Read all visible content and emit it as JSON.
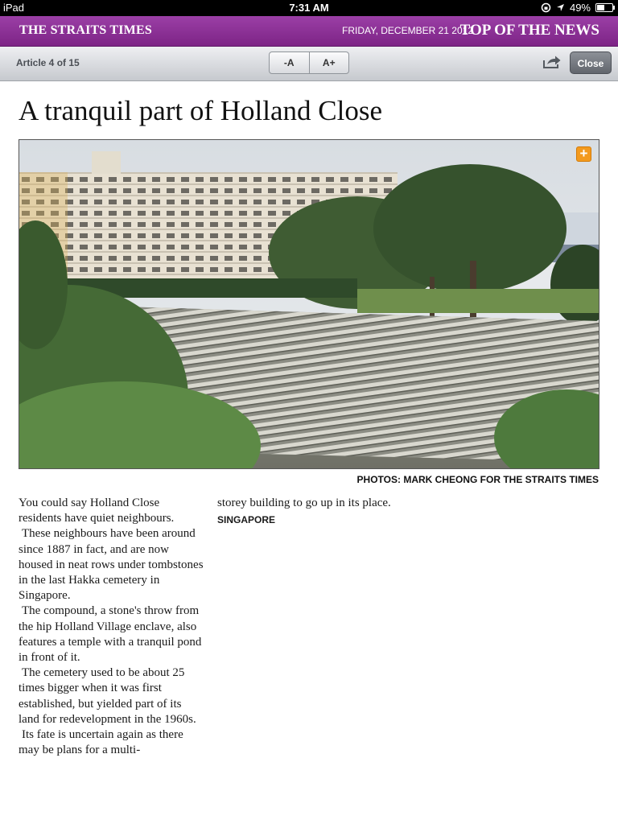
{
  "status_bar": {
    "device": "iPad",
    "time": "7:31 AM",
    "battery": "49%",
    "battery_level": 0.49
  },
  "masthead": {
    "paper_name": "THE STRAITS TIMES",
    "date": "FRIDAY, DECEMBER 21 2012",
    "section": "TOP OF THE NEWS"
  },
  "toolbar": {
    "article_count": "Article 4 of 15",
    "font_decrease": "-A",
    "font_increase": "A+",
    "close_label": "Close",
    "share_icon": "share-icon"
  },
  "article": {
    "headline": "A tranquil part of Holland Close",
    "photo_credit": "PHOTOS: MARK CHEONG FOR THE STRAITS TIMES",
    "photo_expand_icon": "plus-icon",
    "paragraphs": [
      "You could say Holland Close residents have quiet neighbours.",
      "These neighbours have been around since 1887 in fact, and are now housed in neat rows under tombstones in the last Hakka cemetery in Singapore.",
      "The compound, a stone's throw from the hip Holland Village enclave, also features a temple with a tranquil pond in front of it.",
      "The cemetery used to be about 25 times bigger when it was first established, but yielded part of its land for redevelopment in the 1960s.",
      "Its fate is uncertain again as there may be plans for a multi-",
      "storey building to go up in its place."
    ],
    "dateline": "SINGAPORE"
  },
  "colors": {
    "masthead": "#8a2f94",
    "toolbar": "#d8dade",
    "expand": "#f39a1e"
  }
}
